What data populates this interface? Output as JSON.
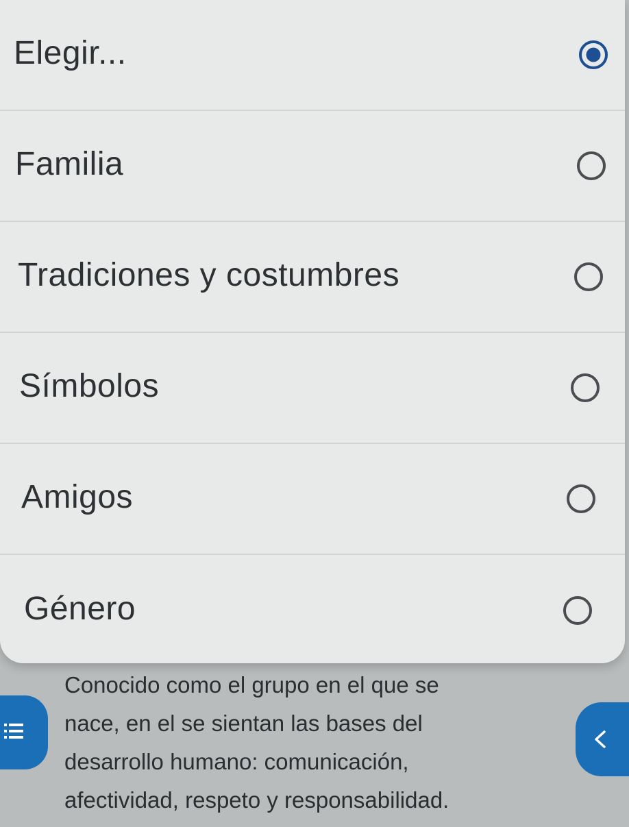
{
  "select": {
    "options": [
      {
        "label": "Elegir...",
        "selected": true
      },
      {
        "label": "Familia",
        "selected": false
      },
      {
        "label": "Tradiciones y costumbres",
        "selected": false
      },
      {
        "label": "Símbolos",
        "selected": false
      },
      {
        "label": "Amigos",
        "selected": false
      },
      {
        "label": "Género",
        "selected": false
      }
    ]
  },
  "question": {
    "lines": [
      "Conocido como el grupo en el que se",
      "nace, en el se sientan las bases del",
      "desarrollo humano: comunicación,",
      "afectividad, respeto y responsabilidad."
    ]
  },
  "icons": {
    "list": "list-icon",
    "back": "chevron-left-icon"
  },
  "colors": {
    "accent": "#1a6fb7",
    "selected_radio": "#1d4f93",
    "panel_bg": "#e8e9e9",
    "page_bg": "#b9bcbd"
  }
}
